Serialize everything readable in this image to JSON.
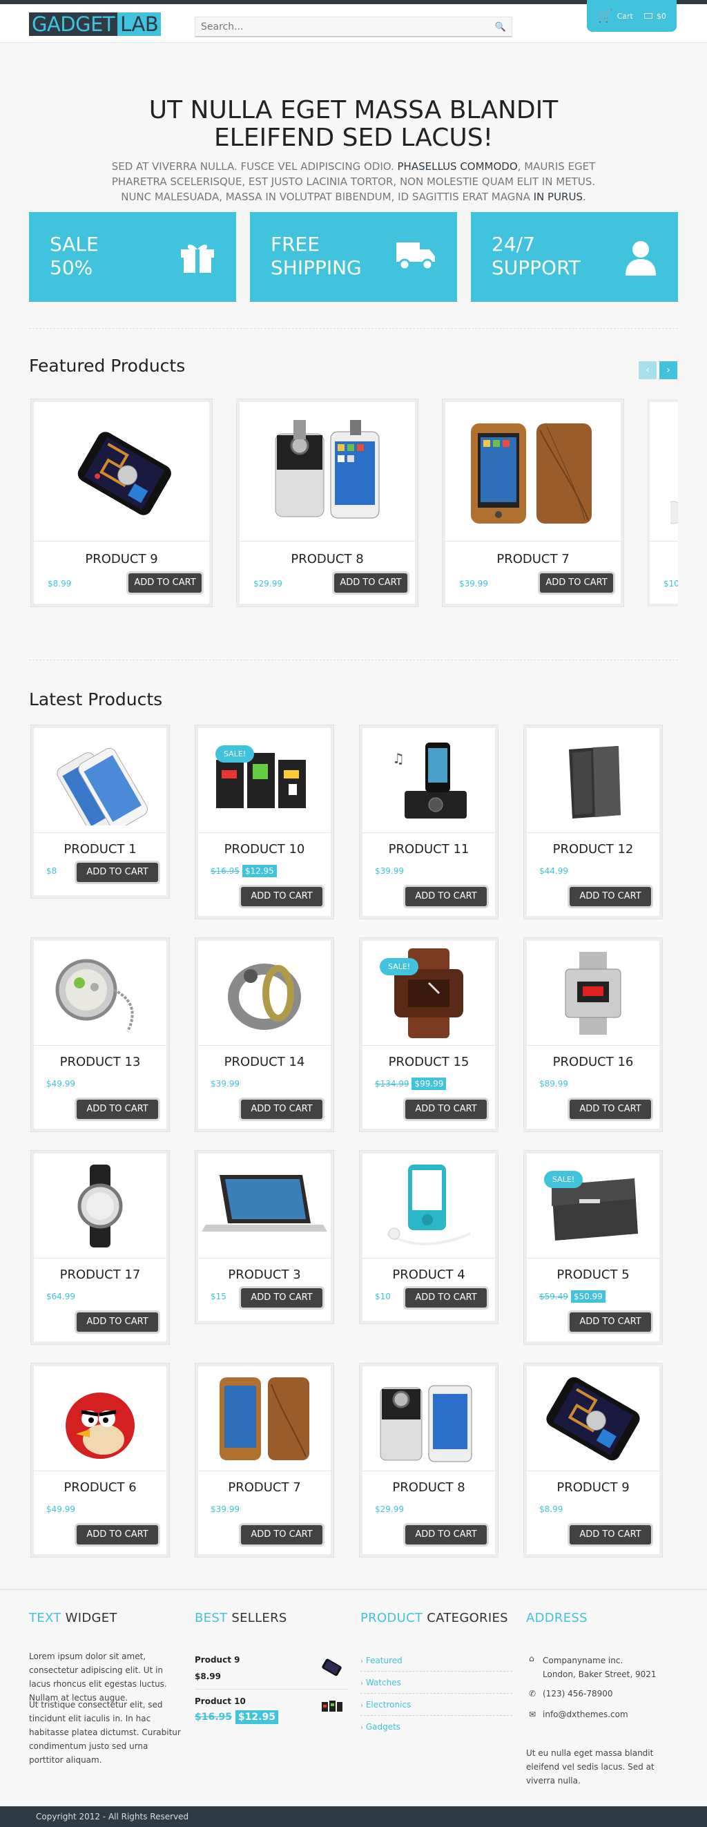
{
  "brand": {
    "part1": "GADGET",
    "part2": "LAB",
    "accent": "#42c3dd",
    "dark": "#2e3a44"
  },
  "search": {
    "placeholder": "Search..."
  },
  "cart": {
    "label": "Cart",
    "total": "$0"
  },
  "hero": {
    "title_line1": "UT NULLA EGET MASSA BLANDIT",
    "title_line2": "ELEIFEND SED LACUS!",
    "sub1": "SED AT VIVERRA NULLA. FUSCE VEL ADIPISCING ODIO.",
    "sub1_hl": "PHASELLUS COMMODO",
    "sub2": ", MAURIS EGET PHARETRA SCELERISQUE, EST JUSTO LACINIA TORTOR, NON MOLESTIE QUAM ELIT IN METUS. NUNC MALESUADA, MASSA IN VOLUTPAT BIBENDUM, ID SAGITTIS ERAT MAGNA",
    "sub2_hl": "IN PURUS",
    "sub_end": "."
  },
  "banners": [
    {
      "line1": "SALE",
      "line2": "50%",
      "icon": "gift-icon"
    },
    {
      "line1": "FREE",
      "line2": "SHIPPING",
      "icon": "truck-icon"
    },
    {
      "line1": "24/7",
      "line2": "SUPPORT",
      "icon": "user-icon"
    }
  ],
  "featured": {
    "title": "Featured Products",
    "items": [
      {
        "name": "PRODUCT 9",
        "price": "$8.99",
        "btn": "ADD TO CART"
      },
      {
        "name": "PRODUCT 8",
        "price": "$29.99",
        "btn": "ADD TO CART"
      },
      {
        "name": "PRODUCT 7",
        "price": "$39.99",
        "btn": "ADD TO CART"
      },
      {
        "price": "$10"
      }
    ]
  },
  "latest": {
    "title": "Latest Products",
    "btn": "ADD TO CART",
    "sale_label": "SALE!",
    "items": [
      {
        "name": "PRODUCT 1",
        "price": "$8"
      },
      {
        "name": "PRODUCT 10",
        "old": "$16.95",
        "new": "$12.95"
      },
      {
        "name": "PRODUCT 11",
        "price": "$39.99"
      },
      {
        "name": "PRODUCT 12",
        "price": "$44.99"
      },
      {
        "name": "PRODUCT 13",
        "price": "$49.99"
      },
      {
        "name": "PRODUCT 14",
        "price": "$39.99"
      },
      {
        "name": "PRODUCT 15",
        "old": "$134.99",
        "new": "$99.99"
      },
      {
        "name": "PRODUCT 16",
        "price": "$89.99"
      },
      {
        "name": "PRODUCT 17",
        "price": "$64.99"
      },
      {
        "name": "PRODUCT 3",
        "price": "$15"
      },
      {
        "name": "PRODUCT 4",
        "price": "$10"
      },
      {
        "name": "PRODUCT 5",
        "old": "$59.49",
        "new": "$50.99"
      },
      {
        "name": "PRODUCT 6",
        "price": "$49.99"
      },
      {
        "name": "PRODUCT 7",
        "price": "$39.99"
      },
      {
        "name": "PRODUCT 8",
        "price": "$29.99"
      },
      {
        "name": "PRODUCT 9",
        "price": "$8.99"
      }
    ]
  },
  "footer": {
    "text_widget": {
      "title_c": "TEXT",
      "title": "WIDGET",
      "p1": "Lorem ipsum dolor sit amet, consectetur adipiscing elit. Ut in lacus rhoncus elit egestas luctus. Nullam at lectus augue.",
      "p2": "Ut tristique consectetur elit, sed tincidunt elit iaculis in. In hac habitasse platea dictumst. Curabitur condimentum justo sed urna porttitor aliquam."
    },
    "best": {
      "title_c": "BEST",
      "title": "SELLERS",
      "i1": {
        "name": "Product 9",
        "price": "$8.99"
      },
      "i2": {
        "name": "Product 10",
        "old": "$16.95",
        "new": "$12.95"
      }
    },
    "cats": {
      "title_c": "PRODUCT",
      "title": "CATEGORIES",
      "items": [
        "Featured",
        "Watches",
        "Electronics",
        "Gadgets"
      ]
    },
    "address": {
      "title_c": "ADDRESS",
      "company": "Companyname inc.",
      "street": "London, Baker Street, 9021",
      "phone": "(123) 456-78900",
      "email": "info@dxthemes.com",
      "note": "Ut eu nulla eget massa blandit eleifend vel sedis lacus. Sed at viverra nulla."
    },
    "copyright": "Copyright 2012 - All Rights Reserved"
  }
}
